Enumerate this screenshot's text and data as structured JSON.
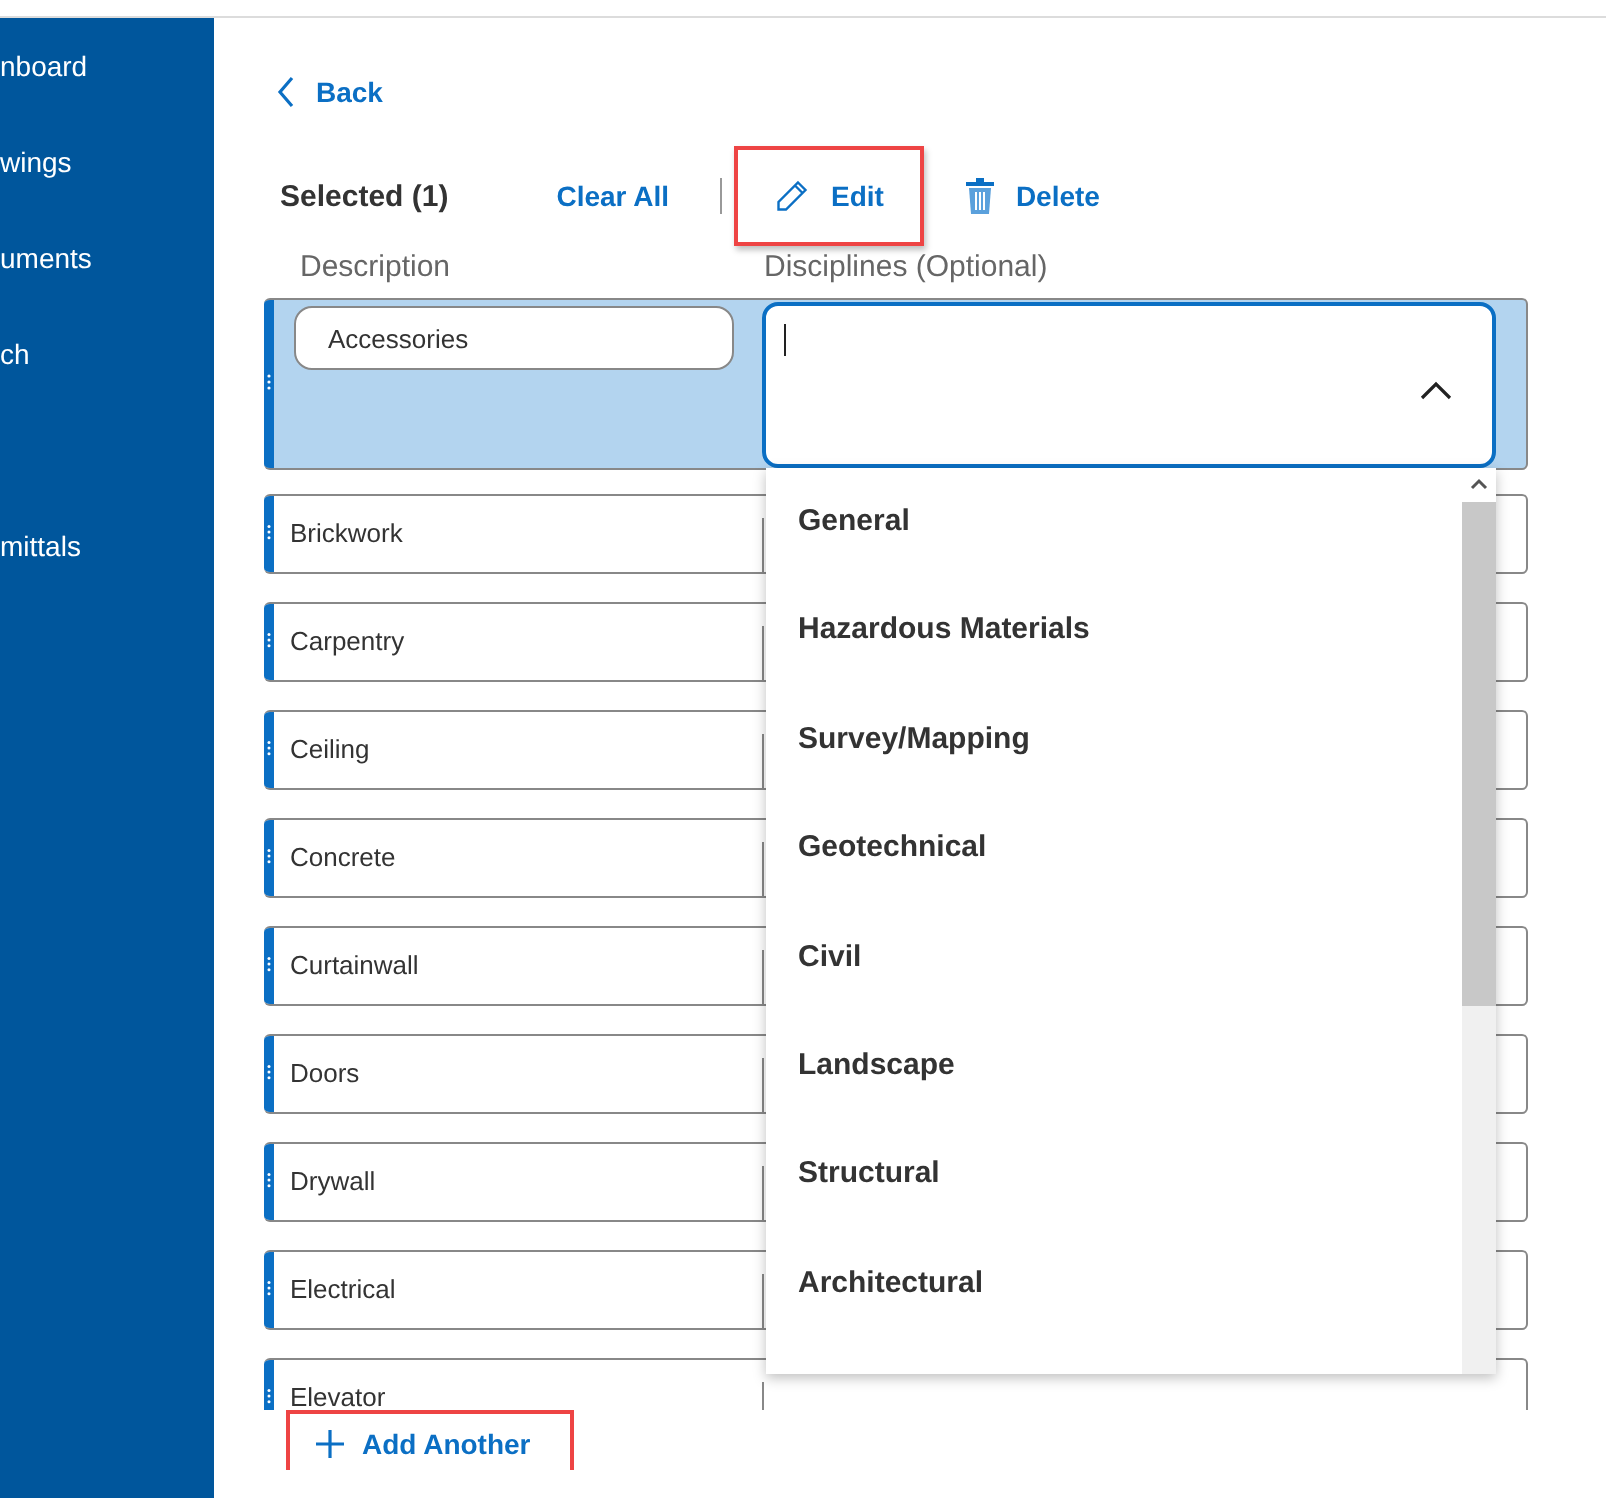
{
  "sidebar": {
    "groups": [
      [
        "nboard",
        "wings",
        "uments",
        "ch"
      ],
      [
        "mittals"
      ]
    ]
  },
  "back": {
    "label": "Back"
  },
  "toolbar": {
    "selected_count": "Selected (1)",
    "actions": [
      {
        "kind": "clear",
        "label": "Clear All",
        "highlighted": false
      },
      {
        "kind": "edit",
        "label": "Edit",
        "highlighted": true
      },
      {
        "kind": "delete",
        "label": "Delete",
        "highlighted": false
      }
    ]
  },
  "columns": [
    "Description",
    "Disciplines (Optional)"
  ],
  "rows": [
    {
      "description": "Accessories",
      "selected": true
    },
    {
      "description": "Brickwork",
      "selected": false
    },
    {
      "description": "Carpentry",
      "selected": false
    },
    {
      "description": "Ceiling",
      "selected": false
    },
    {
      "description": "Concrete",
      "selected": false
    },
    {
      "description": "Curtainwall",
      "selected": false
    },
    {
      "description": "Doors",
      "selected": false
    },
    {
      "description": "Drywall",
      "selected": false
    },
    {
      "description": "Electrical",
      "selected": false
    },
    {
      "description": "Elevator",
      "selected": false
    }
  ],
  "dropdown": {
    "expanded": true,
    "options": [
      "General",
      "Hazardous Materials",
      "Survey/Mapping",
      "Geotechnical",
      "Civil",
      "Landscape",
      "Structural",
      "Architectural"
    ]
  },
  "add_button": {
    "label": "Add Another",
    "highlighted": true
  }
}
